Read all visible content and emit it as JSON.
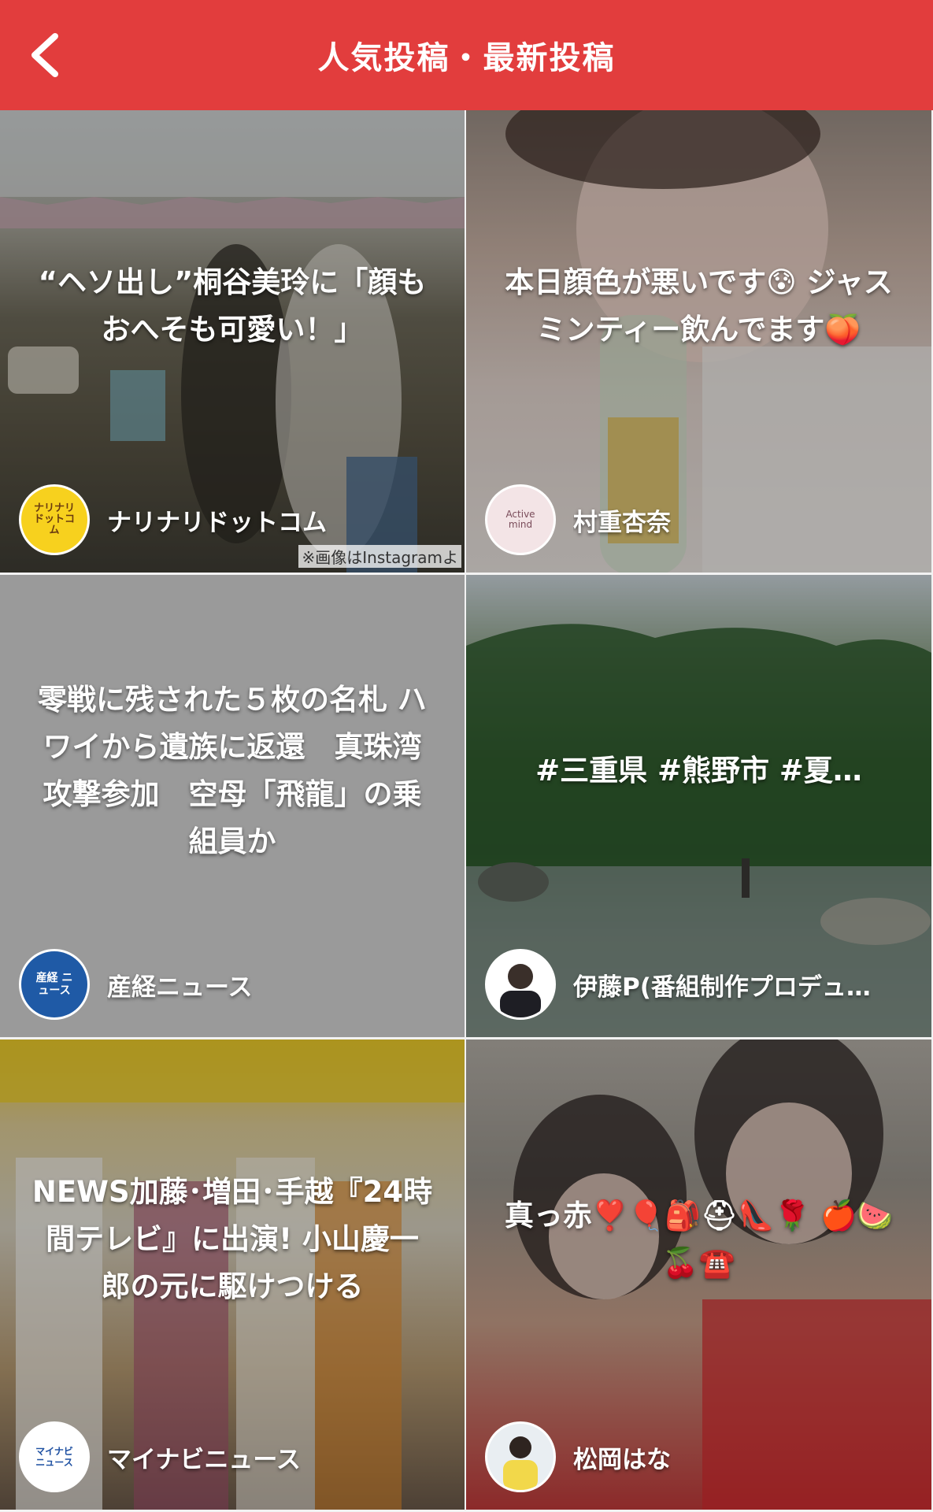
{
  "header": {
    "title": "人気投稿・最新投稿",
    "back_icon": "chevron-left-icon",
    "background": "#e23d3d"
  },
  "cards": [
    {
      "title": "“ヘソ出し”桐谷美玲に「顔もおへそも可愛い！」",
      "author": "ナリナリドットコム",
      "avatar_text": "ナリナリ ドットコム",
      "caption": "※画像はInstagramよ"
    },
    {
      "title": "本日顔色が悪いです😰 ジャスミンティー飲んでます🍑",
      "author": "村重杏奈",
      "avatar_text": "Active mind"
    },
    {
      "title": "零戦に残された５枚の名札 ハワイから遺族に返還　真珠湾攻撃参加　空母「飛龍」の乗組員か",
      "author": "産経ニュース",
      "avatar_text": "産経 ニュース"
    },
    {
      "title": "#三重県 #熊野市 #夏…",
      "author": "伊藤P(番組制作プロデュ…"
    },
    {
      "title": "NEWS加藤･増田･手越『24時間テレビ』に出演! 小山慶一郎の元に駆けつける",
      "author": "マイナビニュース",
      "avatar_text": "マイナビ ニュース"
    },
    {
      "title": "真っ赤❣️🎈🎒⛑👠🌹 🍎🍉🍒☎️",
      "author": "松岡はな"
    }
  ]
}
